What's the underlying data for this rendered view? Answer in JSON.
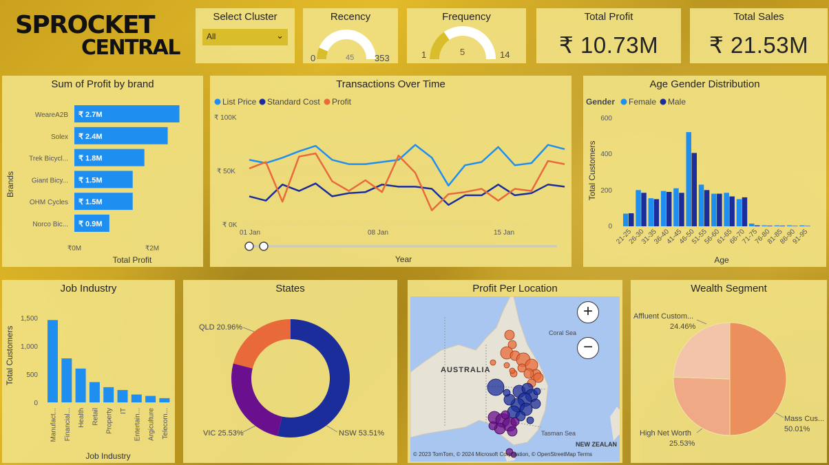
{
  "logo": {
    "line1": "SPROCKET",
    "line2": "CENTRAL"
  },
  "select_cluster": {
    "title": "Select Cluster",
    "value": "All"
  },
  "recency": {
    "title": "Recency",
    "min": "0",
    "value": "45",
    "max": "353",
    "fraction": 0.127
  },
  "frequency": {
    "title": "Frequency",
    "min": "1",
    "value": "5",
    "max": "14",
    "fraction": 0.308
  },
  "total_profit": {
    "title": "Total Profit",
    "value": "₹ 10.73M"
  },
  "total_sales": {
    "title": "Total Sales",
    "value": "₹ 21.53M"
  },
  "profit_by_brand": {
    "title": "Sum of Profit by brand",
    "ylabel": "Brands",
    "xlabel": "Total Profit",
    "xticks": [
      "₹0M",
      "₹2M"
    ],
    "bars": [
      {
        "label": "WeareA2B",
        "value_label": "₹ 2.7M",
        "value": 2.7
      },
      {
        "label": "Solex",
        "value_label": "₹ 2.4M",
        "value": 2.4
      },
      {
        "label": "Trek Bicycl...",
        "value_label": "₹ 1.8M",
        "value": 1.8
      },
      {
        "label": "Giant Bicy...",
        "value_label": "₹ 1.5M",
        "value": 1.5
      },
      {
        "label": "OHM Cycles",
        "value_label": "₹ 1.5M",
        "value": 1.5
      },
      {
        "label": "Norco Bic...",
        "value_label": "₹ 0.9M",
        "value": 0.9
      }
    ]
  },
  "transactions": {
    "title": "Transactions Over Time",
    "legend": [
      "List Price",
      "Standard Cost",
      "Profit"
    ],
    "yticks": [
      "₹ 100K",
      "₹ 50K",
      "₹ 0K"
    ],
    "xticks": [
      "01 Jan",
      "08 Jan",
      "15 Jan"
    ],
    "xlabel": "Year",
    "colors": [
      "#1f8ef1",
      "#1a2d9b",
      "#e8693a"
    ]
  },
  "age_gender": {
    "title": "Age Gender Distribution",
    "legend_title": "Gender",
    "legend": [
      "Female",
      "Male"
    ],
    "ylabel": "Total Customers",
    "xlabel": "Age",
    "yticks": [
      "600",
      "400",
      "200",
      "0"
    ],
    "categories": [
      "21-25",
      "26-30",
      "31-35",
      "36-40",
      "41-45",
      "46-50",
      "51-55",
      "56-60",
      "61-65",
      "66-70",
      "71-75",
      "76-80",
      "81-85",
      "86-90",
      "91-95"
    ],
    "colors": [
      "#1f8ef1",
      "#1a2d9b"
    ]
  },
  "job_industry": {
    "title": "Job Industry",
    "ylabel": "Total Customers",
    "xlabel": "Job Industry",
    "yticks": [
      "1,500",
      "1,000",
      "500",
      "0"
    ],
    "categories": [
      "Manufact...",
      "Financial...",
      "Health",
      "Retail",
      "Property",
      "IT",
      "Entertain...",
      "Argiculture",
      "Telecom..."
    ]
  },
  "states": {
    "title": "States",
    "slices": [
      {
        "label": "NSW 53.51%",
        "value": 53.51,
        "color": "#1a2d9b"
      },
      {
        "label": "VIC 25.53%",
        "value": 25.53,
        "color": "#6a0f8e"
      },
      {
        "label": "QLD 20.96%",
        "value": 20.96,
        "color": "#e8693a"
      }
    ]
  },
  "profit_location": {
    "title": "Profit Per Location",
    "labels": {
      "country": "AUSTRALIA",
      "sea1": "Coral Sea",
      "sea2": "Tasman Sea",
      "nz": "NEW ZEALAN"
    },
    "copyright": "© 2023 TomTom, © 2024 Microsoft Corporation, © OpenStreetMap  Terms",
    "zoom_in": "+",
    "zoom_out": "−"
  },
  "wealth": {
    "title": "Wealth Segment",
    "slices": [
      {
        "label": "Mass Cus...",
        "pct": "50.01%",
        "value": 50.01,
        "color": "#eb8f5c"
      },
      {
        "label": "High Net Worth",
        "pct": "25.53%",
        "value": 25.53,
        "color": "#f0a987"
      },
      {
        "label": "Affluent Custom...",
        "pct": "24.46%",
        "value": 24.46,
        "color": "#f3c4a9"
      }
    ]
  },
  "chart_data": [
    {
      "type": "bar",
      "title": "Sum of Profit by brand",
      "categories": [
        "WeareA2B",
        "Solex",
        "Trek Bicycl...",
        "Giant Bicy...",
        "OHM Cycles",
        "Norco Bic..."
      ],
      "values": [
        2.7,
        2.4,
        1.8,
        1.5,
        1.5,
        0.9
      ],
      "xlabel": "Total Profit",
      "ylabel": "Brands"
    },
    {
      "type": "line",
      "title": "Transactions Over Time",
      "xlabel": "Year",
      "x": [
        "01 Jan",
        "02 Jan",
        "03 Jan",
        "04 Jan",
        "05 Jan",
        "06 Jan",
        "07 Jan",
        "08 Jan",
        "09 Jan",
        "10 Jan",
        "11 Jan",
        "12 Jan",
        "13 Jan",
        "14 Jan",
        "15 Jan",
        "16 Jan",
        "17 Jan",
        "18 Jan",
        "19 Jan",
        "20 Jan"
      ],
      "ylim": [
        0,
        100
      ],
      "series": [
        {
          "name": "List Price",
          "values": [
            60,
            57,
            62,
            68,
            73,
            60,
            56,
            56,
            58,
            60,
            74,
            62,
            36,
            55,
            58,
            72,
            55,
            57,
            74,
            70
          ]
        },
        {
          "name": "Standard Cost",
          "values": [
            26,
            22,
            37,
            31,
            38,
            26,
            29,
            30,
            37,
            35,
            35,
            33,
            18,
            27,
            27,
            37,
            27,
            29,
            37,
            35
          ]
        },
        {
          "name": "Profit",
          "values": [
            52,
            58,
            21,
            63,
            66,
            40,
            31,
            41,
            30,
            64,
            48,
            13,
            28,
            30,
            33,
            22,
            33,
            31,
            59,
            56
          ]
        }
      ]
    },
    {
      "type": "bar",
      "title": "Age Gender Distribution",
      "categories": [
        "21-25",
        "26-30",
        "31-35",
        "36-40",
        "41-45",
        "46-50",
        "51-55",
        "56-60",
        "61-65",
        "66-70",
        "71-75",
        "76-80",
        "81-85",
        "86-90",
        "91-95"
      ],
      "series": [
        {
          "name": "Female",
          "values": [
            70,
            200,
            155,
            195,
            210,
            520,
            230,
            180,
            185,
            150,
            15,
            5,
            5,
            5,
            5
          ]
        },
        {
          "name": "Male",
          "values": [
            72,
            185,
            150,
            190,
            185,
            405,
            200,
            180,
            165,
            160,
            5,
            3,
            3,
            2,
            2
          ]
        }
      ],
      "ylim": [
        0,
        600
      ],
      "ylabel": "Total Customers",
      "xlabel": "Age"
    },
    {
      "type": "bar",
      "title": "Job Industry",
      "categories": [
        "Manufact...",
        "Financial...",
        "Health",
        "Retail",
        "Property",
        "IT",
        "Entertain...",
        "Argiculture",
        "Telecom..."
      ],
      "values": [
        1460,
        780,
        600,
        360,
        270,
        220,
        140,
        115,
        75
      ],
      "ylim": [
        0,
        1500
      ],
      "ylabel": "Total Customers",
      "xlabel": "Job Industry"
    },
    {
      "type": "pie",
      "title": "States",
      "categories": [
        "NSW",
        "VIC",
        "QLD"
      ],
      "values": [
        53.51,
        25.53,
        20.96
      ]
    },
    {
      "type": "pie",
      "title": "Wealth Segment",
      "categories": [
        "Mass Cus...",
        "High Net Worth",
        "Affluent Custom..."
      ],
      "values": [
        50.01,
        25.53,
        24.46
      ]
    }
  ]
}
